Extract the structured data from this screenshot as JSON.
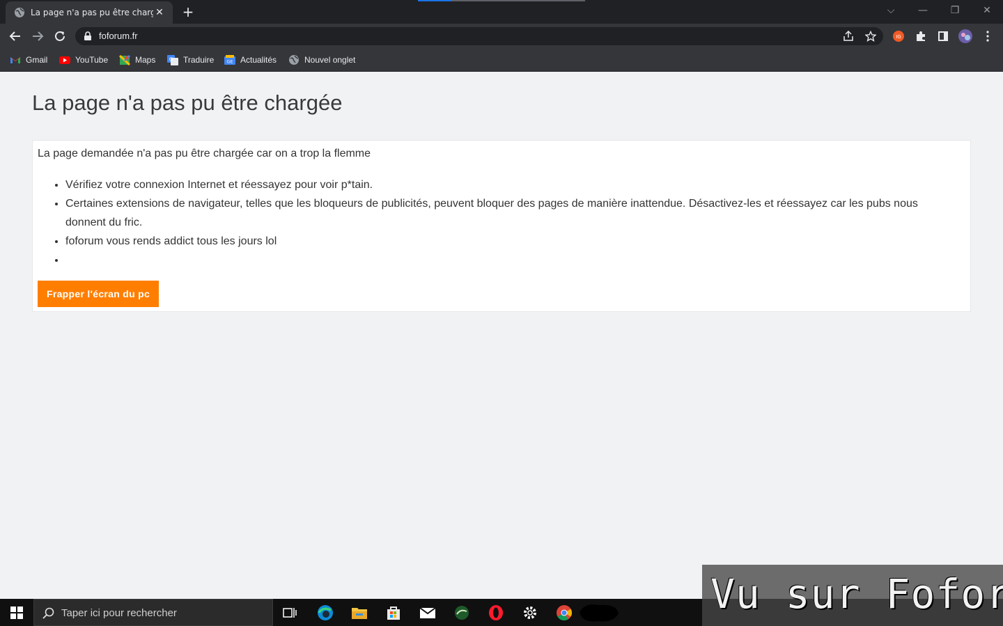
{
  "browser": {
    "tab": {
      "title": "La page n'a pas pu être chargée |"
    },
    "url": "foforum.fr",
    "bookmarks": [
      {
        "label": "Gmail",
        "icon": "gmail-icon"
      },
      {
        "label": "YouTube",
        "icon": "youtube-icon"
      },
      {
        "label": "Maps",
        "icon": "maps-icon"
      },
      {
        "label": "Traduire",
        "icon": "translate-icon"
      },
      {
        "label": "Actualités",
        "icon": "news-icon"
      },
      {
        "label": "Nouvel onglet",
        "icon": "globe-icon"
      }
    ],
    "accent": "#1a73e8"
  },
  "page": {
    "heading": "La page n'a pas pu être chargée",
    "intro": "La page demandée n'a pas pu être chargée car on a trop la flemme",
    "items": [
      "Vérifiez votre connexion Internet et réessayez pour voir p*tain.",
      "Certaines extensions de navigateur, telles que les bloqueurs de publicités, peuvent bloquer des pages de manière inattendue. Désactivez-les et réessayez car les pubs nous donnent du fric.",
      "foforum vous rends addict tous les jours lol",
      ""
    ],
    "button": "Frapper l'écran du pc",
    "button_color": "#ff7e00"
  },
  "taskbar": {
    "search_placeholder": "Taper ici pour rechercher"
  },
  "watermark": "Vu sur Foforum"
}
